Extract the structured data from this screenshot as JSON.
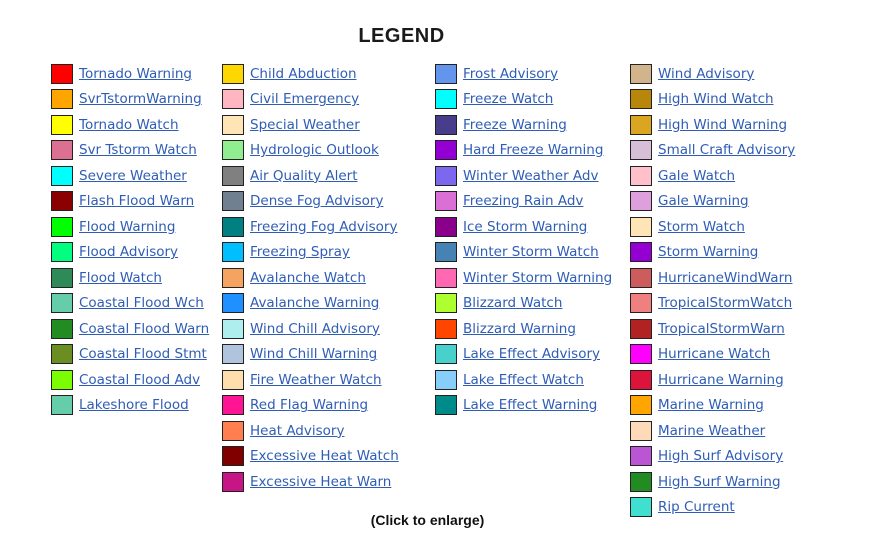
{
  "title": "LEGEND",
  "footer": "(Click to enlarge)",
  "columns": [
    [
      {
        "label": "Tornado Warning",
        "color": "#ff0000"
      },
      {
        "label": "SvrTstormWarning",
        "color": "#ffa500"
      },
      {
        "label": "Tornado Watch",
        "color": "#ffff00"
      },
      {
        "label": "Svr Tstorm Watch",
        "color": "#db7093"
      },
      {
        "label": "Severe Weather",
        "color": "#00ffff"
      },
      {
        "label": "Flash Flood Warn",
        "color": "#8b0000"
      },
      {
        "label": "Flood Warning",
        "color": "#00ff00"
      },
      {
        "label": "Flood Advisory",
        "color": "#00ff7f"
      },
      {
        "label": "Flood Watch",
        "color": "#2e8b57"
      },
      {
        "label": "Coastal Flood Wch",
        "color": "#66cdaa"
      },
      {
        "label": "Coastal Flood Warn",
        "color": "#228b22"
      },
      {
        "label": "Coastal Flood Stmt",
        "color": "#6b8e23"
      },
      {
        "label": "Coastal Flood Adv",
        "color": "#7cfc00"
      },
      {
        "label": "Lakeshore Flood",
        "color": "#66cdaa"
      }
    ],
    [
      {
        "label": "Child Abduction",
        "color": "#ffd700"
      },
      {
        "label": "Civil Emergency",
        "color": "#ffb6c1"
      },
      {
        "label": "Special Weather",
        "color": "#ffe4b5"
      },
      {
        "label": "Hydrologic Outlook",
        "color": "#90ee90"
      },
      {
        "label": "Air Quality Alert",
        "color": "#808080"
      },
      {
        "label": "Dense Fog Advisory",
        "color": "#708090"
      },
      {
        "label": "Freezing Fog Advisory",
        "color": "#008080"
      },
      {
        "label": "Freezing Spray",
        "color": "#00bfff"
      },
      {
        "label": "Avalanche Watch",
        "color": "#f4a460"
      },
      {
        "label": "Avalanche Warning",
        "color": "#1e90ff"
      },
      {
        "label": "Wind Chill Advisory",
        "color": "#afeeee"
      },
      {
        "label": "Wind Chill Warning",
        "color": "#b0c4de"
      },
      {
        "label": "Fire Weather Watch",
        "color": "#ffdead"
      },
      {
        "label": "Red Flag Warning",
        "color": "#ff1493"
      },
      {
        "label": "Heat Advisory",
        "color": "#ff7f50"
      },
      {
        "label": "Excessive Heat Watch",
        "color": "#800000"
      },
      {
        "label": "Excessive Heat Warn",
        "color": "#c71585"
      }
    ],
    [
      {
        "label": "Frost Advisory",
        "color": "#6495ed"
      },
      {
        "label": "Freeze Watch",
        "color": "#00ffff"
      },
      {
        "label": "Freeze Warning",
        "color": "#483d8b"
      },
      {
        "label": "Hard Freeze Warning",
        "color": "#9400d3"
      },
      {
        "label": "Winter Weather Adv",
        "color": "#7b68ee"
      },
      {
        "label": "Freezing Rain Adv",
        "color": "#da70d6"
      },
      {
        "label": "Ice Storm Warning",
        "color": "#8b008b"
      },
      {
        "label": "Winter Storm Watch",
        "color": "#4682b4"
      },
      {
        "label": "Winter Storm Warning",
        "color": "#ff69b4"
      },
      {
        "label": "Blizzard Watch",
        "color": "#adff2f"
      },
      {
        "label": "Blizzard Warning",
        "color": "#ff4500"
      },
      {
        "label": "Lake Effect Advisory",
        "color": "#48d1cc"
      },
      {
        "label": "Lake Effect Watch",
        "color": "#87cefa"
      },
      {
        "label": "Lake Effect Warning",
        "color": "#008b8b"
      }
    ],
    [
      {
        "label": "Wind Advisory",
        "color": "#d2b48c"
      },
      {
        "label": "High Wind Watch",
        "color": "#b8860b"
      },
      {
        "label": "High Wind Warning",
        "color": "#daa520"
      },
      {
        "label": "Small Craft Advisory",
        "color": "#d8bfd8"
      },
      {
        "label": "Gale Watch",
        "color": "#ffc0cb"
      },
      {
        "label": "Gale Warning",
        "color": "#dda0dd"
      },
      {
        "label": "Storm Watch",
        "color": "#ffe4b5"
      },
      {
        "label": "Storm Warning",
        "color": "#9400d3"
      },
      {
        "label": "HurricaneWindWarn",
        "color": "#cd5c5c"
      },
      {
        "label": "TropicalStormWatch",
        "color": "#f08080"
      },
      {
        "label": "TropicalStormWarn",
        "color": "#b22222"
      },
      {
        "label": "Hurricane Watch",
        "color": "#ff00ff"
      },
      {
        "label": "Hurricane Warning",
        "color": "#dc143c"
      },
      {
        "label": "Marine Warning",
        "color": "#ffa500"
      },
      {
        "label": "Marine Weather",
        "color": "#ffdab9"
      },
      {
        "label": "High Surf Advisory",
        "color": "#ba55d3"
      },
      {
        "label": "High Surf Warning",
        "color": "#228b22"
      },
      {
        "label": "Rip Current",
        "color": "#40e0d0"
      }
    ]
  ]
}
